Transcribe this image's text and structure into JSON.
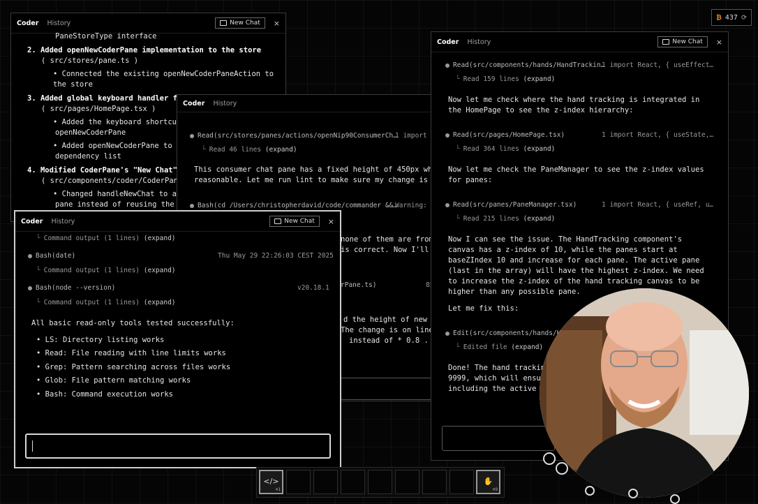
{
  "counter": {
    "icon": "bitcoin-icon",
    "value": "437",
    "refresh_icon": "refresh-icon"
  },
  "pane_common": {
    "tab_coder": "Coder",
    "tab_history": "History",
    "new_chat": "New Chat",
    "close": "×"
  },
  "pane1": {
    "lines": [
      "PaneStoreType  interface",
      "2. Added  openNewCoderPane  implementation to the store",
      "( src/stores/pane.ts )",
      "• Connected the existing  openNewCoderPaneAction  to",
      "the store",
      "3. Added global keyboard handler f",
      "( src/pages/HomePage.tsx )",
      "• Added the keyboard shortcut h",
      "openNewCoderPane",
      "• Added  openNewCoderPane  to th",
      "dependency list",
      "4. Modified CoderPane's \"New Chat\"",
      "( src/components/coder/CoderPane",
      "• Changed  handleNewChat  to alw",
      "pane instead of reusing the"
    ]
  },
  "pane2": {
    "read1": "Read(src/stores/panes/actions/openNip90ConsumerCh…",
    "read1_meta": "1 import",
    "read1_sub": "Read 46 lines",
    "expand": "(expand)",
    "text1": "This consumer chat pane has a fixed height of 450px wh",
    "text2": "reasonable. Let me run lint to make sure my change is",
    "bash1": "Bash(cd /Users/christopherdavid/code/commander &&…",
    "bash1_meta": "Warning: E",
    "t3": "none of them are from",
    "t4": "is correct. Now I'll",
    "t5": "rPane.ts)",
    "t5b": "85",
    "t6": "d the height of new c",
    "t7": "The change is on line",
    "t8": "instead of  * 0.8 ."
  },
  "pane3": {
    "l1_sub": "Command output (1 lines)",
    "expand": "(expand)",
    "bash_date": "Bash(date)",
    "bash_date_meta": "Thu May 29 22:26:03 CEST 2025",
    "l2_sub": "Command output (1 lines)",
    "bash_node": "Bash(node --version)",
    "bash_node_meta": "v20.18.1",
    "l3_sub": "Command output (1 lines)",
    "summary": "All basic read-only tools tested successfully:",
    "bullets": [
      "LS: Directory listing works",
      "Read: File reading with line limits works",
      "Grep: Pattern searching across files works",
      "Glob: File pattern matching works",
      "Bash: Command execution works"
    ]
  },
  "pane4": {
    "read1": "Read(src/components/hands/HandTrackin…",
    "read1_meta": "1 import React, { useEffect…",
    "read1_sub": "Read 159 lines",
    "expand": "(expand)",
    "p1a": "Now let me check where the hand tracking is integrated in",
    "p1b": "the HomePage to see the z-index hierarchy:",
    "read2": "Read(src/pages/HomePage.tsx)",
    "read2_meta": "1 import React, { useState,…",
    "read2_sub": "Read 364 lines",
    "p2a": "Now let me check the PaneManager to see the z-index values",
    "p2b": "for panes:",
    "read3": "Read(src/panes/PaneManager.tsx)",
    "read3_meta": "1 import React, { useRef, u…",
    "read3_sub": "Read 215 lines",
    "p3": [
      "Now I can see the issue. The HandTracking component's",
      "canvas has a z-index of 10, while the panes start at",
      "baseZIndex 10 and increase for each pane. The active pane",
      "(last in the array) will have the highest z-index. We need",
      "to increase the z-index of the hand tracking canvas to be",
      "higher than any possible pane."
    ],
    "p4": "Let me fix this:",
    "edit1": "Edit(src/components/hands/Ha",
    "edit1_sub": "Edited file",
    "p5a": "Done! The hand trackin",
    "p5b": "9999, which will ensu",
    "p5c": "including the active"
  },
  "toolbar": {
    "code_hotkey": "⌘1",
    "hand_hotkey": "⌘9"
  }
}
